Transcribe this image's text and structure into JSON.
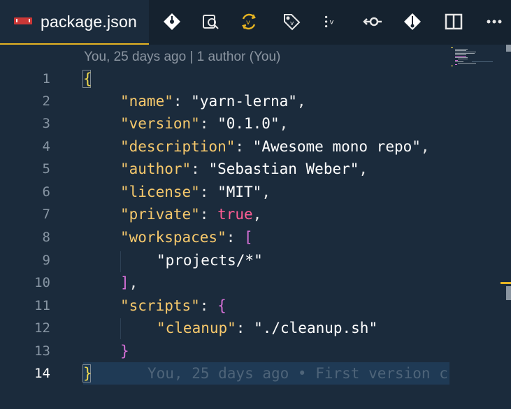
{
  "tab": {
    "title": "package.json"
  },
  "toolbar": {
    "icons": [
      "git-commit-icon",
      "compare-icon",
      "sync-icon",
      "tag-icon",
      "more-actions-icon",
      "previous-change-icon",
      "git-compare-icon",
      "split-editor-icon",
      "ellipsis-icon"
    ],
    "more_actions_label": "v"
  },
  "blame_header": "You, 25 days ago | 1 author (You)",
  "line_numbers": [
    "1",
    "2",
    "3",
    "4",
    "5",
    "6",
    "7",
    "8",
    "9",
    "10",
    "11",
    "12",
    "13",
    "14"
  ],
  "code": {
    "l1": "{",
    "name_key": "\"name\"",
    "name_val": "\"yarn-lerna\"",
    "version_key": "\"version\"",
    "version_val": "\"0.1.0\"",
    "description_key": "\"description\"",
    "description_val": "\"Awesome mono repo\"",
    "author_key": "\"author\"",
    "author_val": "\"Sebastian Weber\"",
    "license_key": "\"license\"",
    "license_val": "\"MIT\"",
    "private_key": "\"private\"",
    "private_val": "true",
    "workspaces_key": "\"workspaces\"",
    "workspaces_open": "[",
    "workspaces_item": "\"projects/*\"",
    "workspaces_close": "]",
    "scripts_key": "\"scripts\"",
    "scripts_open": "{",
    "cleanup_key": "\"cleanup\"",
    "cleanup_val": "\"./cleanup.sh\"",
    "scripts_close": "}",
    "l14": "}"
  },
  "inline_blame": "You, 25 days ago • First version c",
  "colors": {
    "background": "#1b2b3c",
    "tab_accent": "#e6b422",
    "key": "#f7c96c",
    "boolean": "#ff5d94",
    "bracket": "#d770d8",
    "brace": "#f0d94f"
  }
}
